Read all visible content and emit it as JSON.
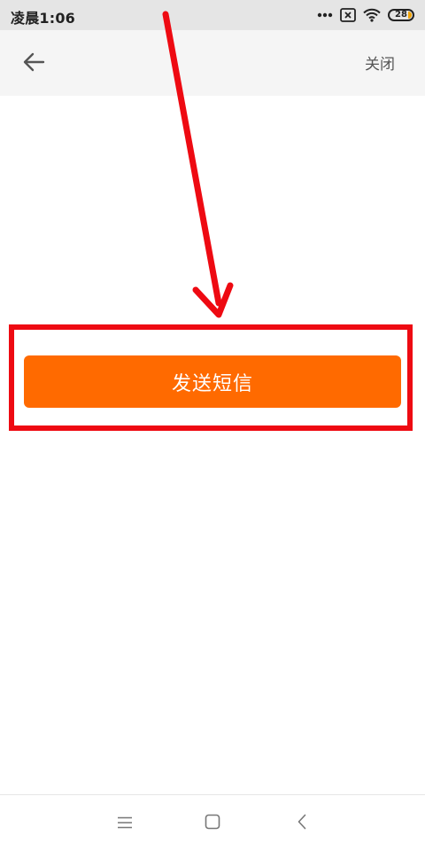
{
  "status_bar": {
    "time": "凌晨1:06",
    "battery_level": "28",
    "icons": [
      "more-dots-icon",
      "sim-blocked-icon",
      "wifi-icon",
      "battery-icon"
    ]
  },
  "header": {
    "back_icon": "arrow-left-icon",
    "close_label": "关闭"
  },
  "main": {
    "send_sms_label": "发送短信",
    "button_color": "#ff6a00"
  },
  "annotation": {
    "color": "#ee0a12",
    "kind": "arrow-and-box"
  },
  "bottom_nav": {
    "icons": [
      "menu-icon",
      "home-square-icon",
      "back-chevron-icon"
    ]
  }
}
